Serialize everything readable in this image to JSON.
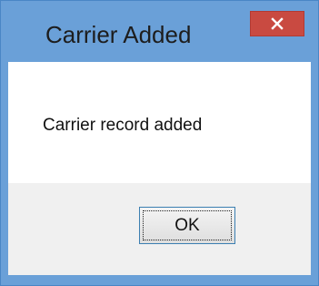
{
  "dialog": {
    "title": "Carrier Added",
    "message": "Carrier record added",
    "ok_label": "OK",
    "close_icon": "close-icon"
  },
  "colors": {
    "frame": "#6aa0d8",
    "close_button": "#c94a41",
    "footer": "#f0f0f0",
    "button_border": "#3c7fb1"
  }
}
